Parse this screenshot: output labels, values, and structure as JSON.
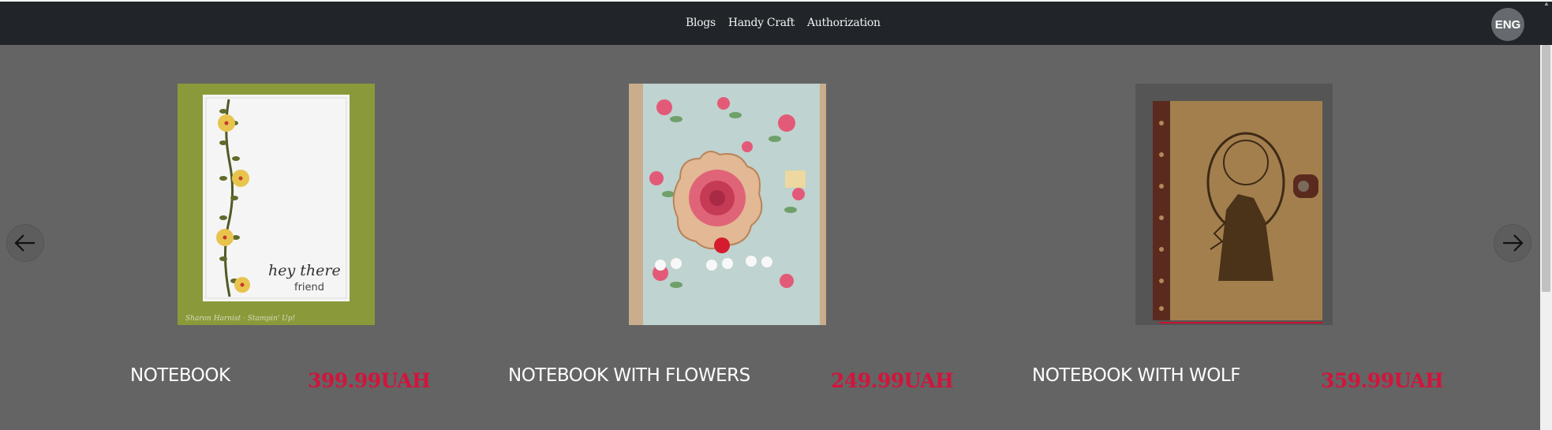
{
  "nav": {
    "links": [
      "Blogs",
      "Handy Craft",
      "Authorization"
    ],
    "language": "ENG"
  },
  "carousel": {
    "prev_icon": "arrow-left-icon",
    "next_icon": "arrow-right-icon",
    "products": [
      {
        "name": "NOTEBOOK",
        "price": "399.99UAH",
        "image": "notebook-card-image"
      },
      {
        "name": "NOTEBOOK WITH FLOWERS",
        "price": "249.99UAH",
        "image": "notebook-flowers-image"
      },
      {
        "name": "NOTEBOOK WITH WOLF",
        "price": "359.99UAH",
        "image": "notebook-wolf-image"
      }
    ]
  },
  "colors": {
    "navbar": "#212428",
    "background": "#646464",
    "price": "#d2143c"
  }
}
